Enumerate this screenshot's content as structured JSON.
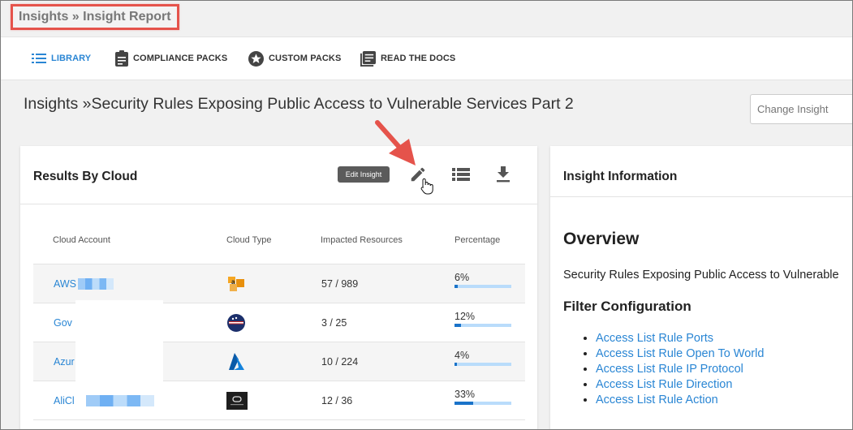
{
  "breadcrumb": "Insights » Insight Report",
  "nav": {
    "library": "LIBRARY",
    "compliance_packs": "COMPLIANCE PACKS",
    "custom_packs": "CUSTOM PACKS",
    "read_the_docs": "READ THE DOCS"
  },
  "page_title": "Insights »Security Rules Exposing Public Access to Vulnerable Services Part 2",
  "change_insight_placeholder": "Change Insight",
  "results": {
    "title": "Results By Cloud",
    "tooltip": "Edit Insight",
    "columns": [
      "Cloud Account",
      "Cloud Type",
      "Impacted Resources",
      "Percentage"
    ],
    "rows": [
      {
        "account": "AWS",
        "cloud_type": "aws-icon",
        "impacted": "57 / 989",
        "percentage": "6%",
        "fraction": 0.06
      },
      {
        "account": "Gov",
        "cloud_type": "gov-cloud-icon",
        "impacted": "3 / 25",
        "percentage": "12%",
        "fraction": 0.12
      },
      {
        "account": "Azur",
        "cloud_type": "azure-icon",
        "impacted": "10 / 224",
        "percentage": "4%",
        "fraction": 0.04
      },
      {
        "account": "AliCl",
        "cloud_type": "alibaba-cloud-icon",
        "impacted": "12 / 36",
        "percentage": "33%",
        "fraction": 0.33
      }
    ]
  },
  "info": {
    "title": "Insight Information",
    "overview_title": "Overview",
    "overview_text": "Security Rules Exposing Public Access to Vulnerable",
    "filter_title": "Filter Configuration",
    "filters": [
      "Access List Rule Ports",
      "Access List Rule Open To World",
      "Access List Rule IP Protocol",
      "Access List Rule Direction",
      "Access List Rule Action"
    ]
  },
  "colors": {
    "accent": "#2a86d4",
    "highlight": "#e5534b",
    "bar_track": "#b9dcfb",
    "bar_fill": "#1a73c9"
  }
}
